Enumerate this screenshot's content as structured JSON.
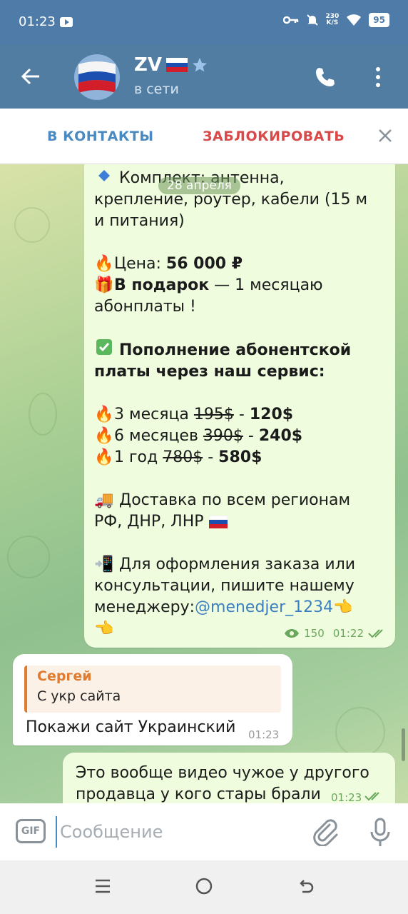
{
  "status_bar": {
    "time": "01:23",
    "net_speed_top": "230",
    "net_speed_bottom": "K/S",
    "battery": "95"
  },
  "header": {
    "name": "ZV",
    "status": "в сети"
  },
  "contact_bar": {
    "add_label": "В КОНТАКТЫ",
    "block_label": "ЗАБЛОКИРОВАТЬ"
  },
  "date_pill": "28 апреля",
  "channel_post": {
    "kit_line1": "Комплект: антенна,",
    "kit_line2": "крепление, роутер, кабели (15 м",
    "kit_line3": "и питания)",
    "price_prefix": "Цена: ",
    "price": "56 000 ₽",
    "gift_bold": "В подарок",
    "gift_rest": " — 1 месяцаю",
    "gift_line2": "абонплаты !",
    "topup_line1": "Пополнение абонентской",
    "topup_line2": "платы через наш сервис:",
    "plans": [
      {
        "label": "3 месяца ",
        "old": "195$",
        "sep": " - ",
        "new": "120$"
      },
      {
        "label": "6 месяцев ",
        "old": "390$",
        "sep": " - ",
        "new": "240$"
      },
      {
        "label": "1 год ",
        "old": "780$",
        "sep": " - ",
        "new": "580$"
      }
    ],
    "delivery_line1": "Доставка по всем регионам",
    "delivery_line2": "РФ, ДНР, ЛНР",
    "order_line1": "Для оформления заказа или",
    "order_line2": "консультации, пишите нашему",
    "order_line3_prefix": "менеджеру:",
    "manager_link": "@menedjer_1234",
    "views": "150",
    "time": "01:22"
  },
  "incoming_message": {
    "reply_name": "Сергей",
    "reply_text": "С укр сайта",
    "text": "Покажи сайт Украинский",
    "time": "01:23"
  },
  "outgoing_message": {
    "text": "Это вообще видео чужое у другого продавца у кого стары брали",
    "time": "01:23"
  },
  "input": {
    "gif_label": "GIF",
    "placeholder": "Сообщение"
  },
  "colors": {
    "header": "#517da2",
    "accent": "#4a8ac2",
    "danger": "#d84a4a",
    "bubble_out": "#effdde",
    "reply_accent": "#e07b2f"
  }
}
